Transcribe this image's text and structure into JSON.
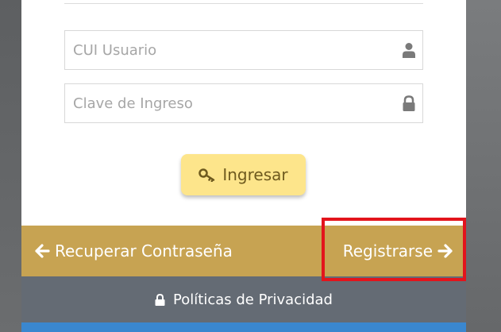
{
  "login_form": {
    "user_placeholder": "CUI Usuario",
    "user_icon": "user-icon",
    "password_placeholder": "Clave de Ingreso",
    "password_icon": "lock-icon",
    "submit_label": "Ingresar",
    "submit_icon": "key-icon"
  },
  "footer": {
    "recover_label": "Recuperar Contraseña",
    "recover_icon": "arrow-left-icon",
    "register_label": "Registrarse",
    "register_icon": "arrow-right-icon",
    "privacy_label": "Políticas de Privacidad",
    "privacy_icon": "lock-icon"
  },
  "colors": {
    "login_button": "#fde58b",
    "gold_bar": "#c7a352",
    "privacy_bar": "#646b74",
    "bottom_bar": "#3a87cf",
    "highlight_box": "#e3141c"
  }
}
